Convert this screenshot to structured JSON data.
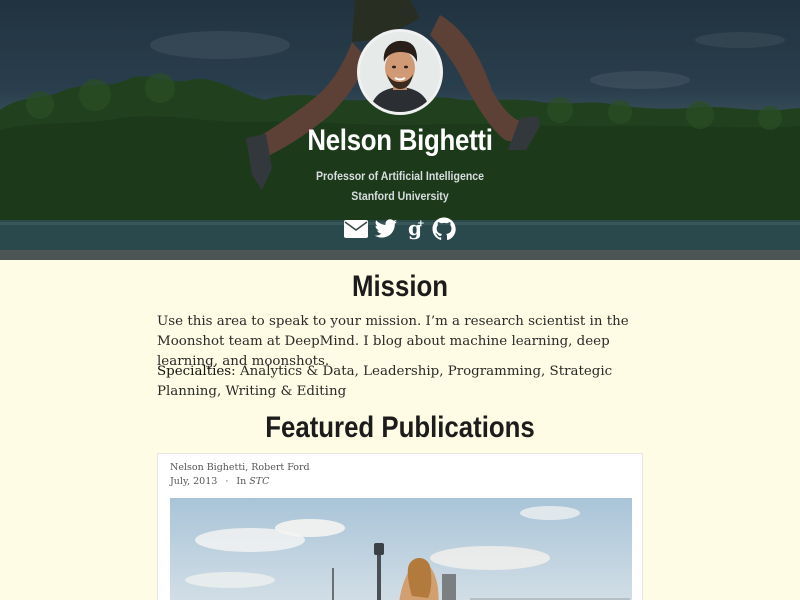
{
  "hero": {
    "name": "Nelson Bighetti",
    "role": "Professor of Artificial Intelligence",
    "organization": "Stanford University",
    "social_links": [
      {
        "icon": "envelope-icon"
      },
      {
        "icon": "twitter-icon"
      },
      {
        "icon": "google-plus-icon"
      },
      {
        "icon": "github-icon"
      }
    ]
  },
  "mission": {
    "title": "Mission",
    "text": "Use this area to speak to your mission. I’m a research scientist in the Moonshot team at DeepMind. I blog about machine learning, deep learning, and moonshots.",
    "specialties_label": "Specialties:",
    "specialties_text": " Analytics & Data, Leadership, Programming, Strategic Planning, Writing & Editing"
  },
  "publications": {
    "title": "Featured Publications",
    "items": [
      {
        "authors": "Nelson Bighetti, Robert Ford",
        "date": "July, 2013",
        "separator": "·",
        "in_label": "In",
        "venue": "STC"
      }
    ]
  },
  "colors": {
    "page_background": "#fefce4",
    "hero_text": "#ffffff",
    "hero_subtext": "#d8dde0",
    "heading": "#1c1c1c"
  }
}
